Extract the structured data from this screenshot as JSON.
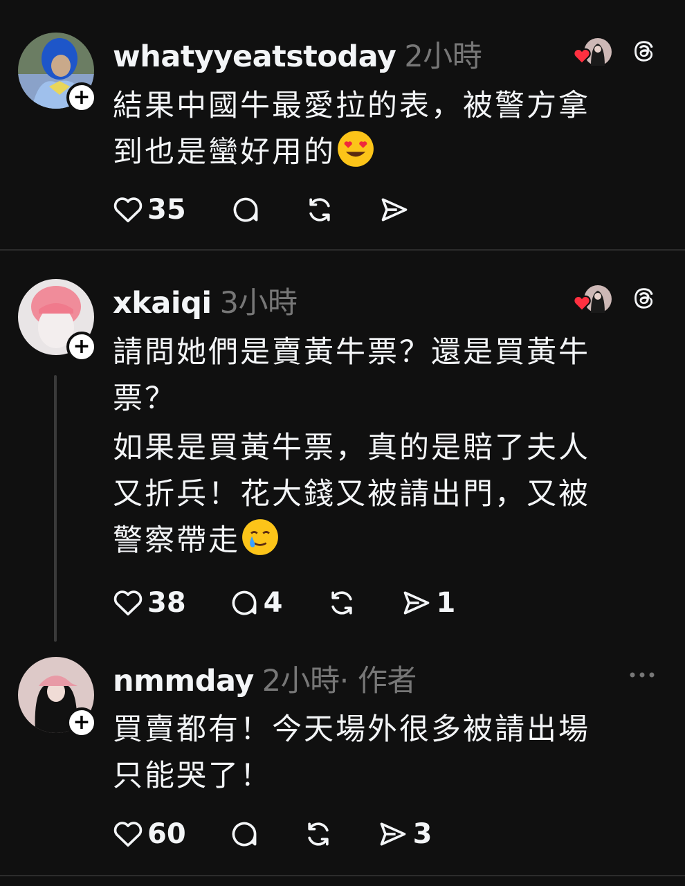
{
  "comments": [
    {
      "username": "whatyyeatstoday",
      "time": "2小時",
      "lines": [
        "結果中國牛最愛拉的表，被警方拿",
        "到也是蠻好用的"
      ],
      "emoji": "heart-eyes-emoji",
      "likes": "35",
      "replies": "",
      "reposts": "",
      "shares": ""
    },
    {
      "username": "xkaiqi",
      "time": "3小時",
      "paragraph1": [
        "請問她們是賣黃牛票？還是買黃牛",
        "票？"
      ],
      "paragraph2": [
        "如果是買黃牛票，真的是賠了夫人",
        "又折兵！花大錢又被請出門，又被",
        "警察帶走"
      ],
      "emoji": "crying-smile-emoji",
      "likes": "38",
      "replies": "4",
      "reposts": "",
      "shares": "1"
    },
    {
      "username": "nmmday",
      "time": "2小時",
      "author_label": "· 作者",
      "lines": [
        "買賣都有！今天場外很多被請出場",
        "只能哭了！"
      ],
      "likes": "60",
      "replies": "",
      "reposts": "",
      "shares": "3"
    }
  ],
  "icons": {
    "like": "heart-outline-icon",
    "reply": "speech-bubble-icon",
    "repost": "repost-icon",
    "share": "send-icon",
    "threads": "threads-logo-icon",
    "more": "more-dots-icon"
  },
  "colors": {
    "background": "#101010",
    "text": "#f3f5f7",
    "muted": "#777777",
    "heart_red": "#ff3040",
    "divider": "#2c2c2c"
  }
}
